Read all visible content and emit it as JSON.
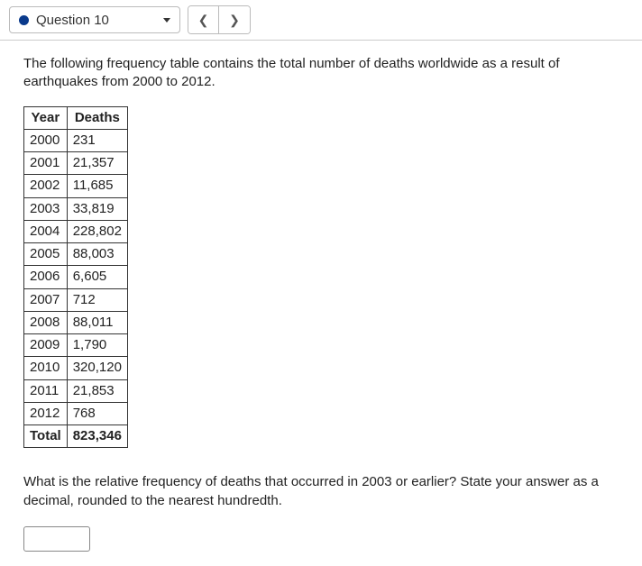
{
  "nav": {
    "question_label": "Question 10"
  },
  "intro": "The following frequency table contains the total number of deaths worldwide as a result of earthquakes from 2000 to 2012.",
  "table": {
    "headers": [
      "Year",
      "Deaths"
    ],
    "rows": [
      {
        "year": "2000",
        "deaths": "231"
      },
      {
        "year": "2001",
        "deaths": "21,357"
      },
      {
        "year": "2002",
        "deaths": "11,685"
      },
      {
        "year": "2003",
        "deaths": "33,819"
      },
      {
        "year": "2004",
        "deaths": "228,802"
      },
      {
        "year": "2005",
        "deaths": "88,003"
      },
      {
        "year": "2006",
        "deaths": "6,605"
      },
      {
        "year": "2007",
        "deaths": "712"
      },
      {
        "year": "2008",
        "deaths": "88,011"
      },
      {
        "year": "2009",
        "deaths": "1,790"
      },
      {
        "year": "2010",
        "deaths": "320,120"
      },
      {
        "year": "2011",
        "deaths": "21,853"
      },
      {
        "year": "2012",
        "deaths": "768"
      }
    ],
    "total": {
      "label": "Total",
      "value": "823,346"
    }
  },
  "question": "What is the relative frequency of deaths that occurred in 2003 or earlier? State your answer as a decimal, rounded to the nearest hundredth.",
  "answer": {
    "value": ""
  }
}
